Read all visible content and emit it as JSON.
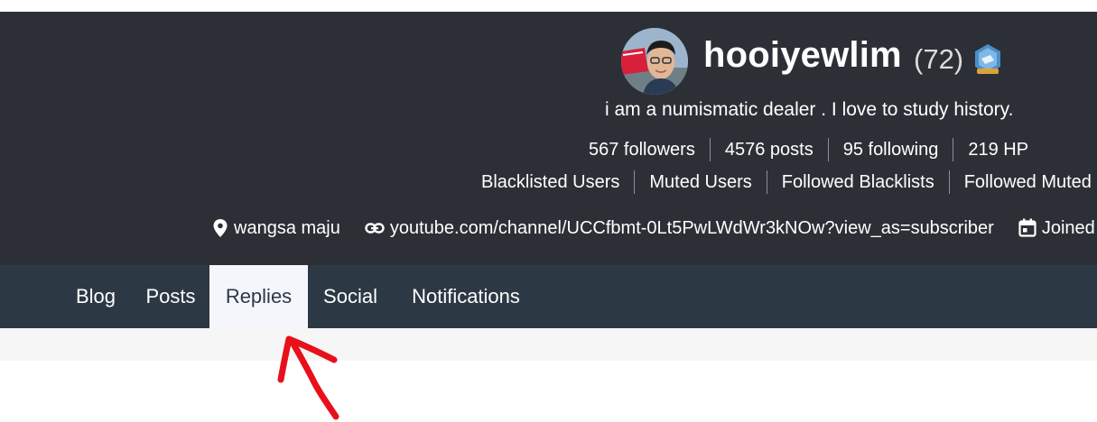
{
  "profile": {
    "username": "hooiyewlim",
    "reputation": "(72)",
    "about": "i am a numismatic dealer . I love to study history.",
    "badge_icon": "hive-badge-icon"
  },
  "stats": {
    "followers": "567 followers",
    "posts": "4576 posts",
    "following": "95 following",
    "hp": "219 HP"
  },
  "lists": {
    "blacklisted": "Blacklisted Users",
    "muted": "Muted Users",
    "followed_blacklists": "Followed Blacklists",
    "followed_muted": "Followed Muted Lists"
  },
  "meta": {
    "location": "wangsa maju",
    "website": "youtube.com/channel/UCCfbmt-0Lt5PwLWdWr3kNOw?view_as=subscriber",
    "joined": "Joined"
  },
  "tabs": [
    {
      "label": "Blog"
    },
    {
      "label": "Posts"
    },
    {
      "label": "Replies",
      "active": true
    },
    {
      "label": "Social"
    },
    {
      "label": "Notifications"
    }
  ],
  "colors": {
    "header_bg": "#2c3036",
    "nav_bg": "#2c3944",
    "active_tab_bg": "#f4f6fb",
    "annotation": "#e8101a"
  }
}
